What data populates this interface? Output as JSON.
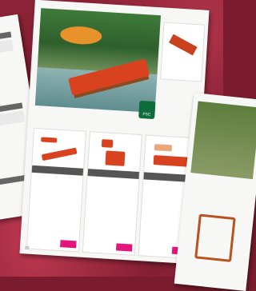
{
  "scene": {
    "description_hidden": "",
    "colors": {
      "accent": "#e4147b",
      "wood": "#d8421f",
      "badge": "#e7922b",
      "fsc": "#0e6b3a"
    }
  },
  "catalog": {
    "badge_text": "",
    "page_number": "20",
    "fsc_label": "FSC"
  }
}
